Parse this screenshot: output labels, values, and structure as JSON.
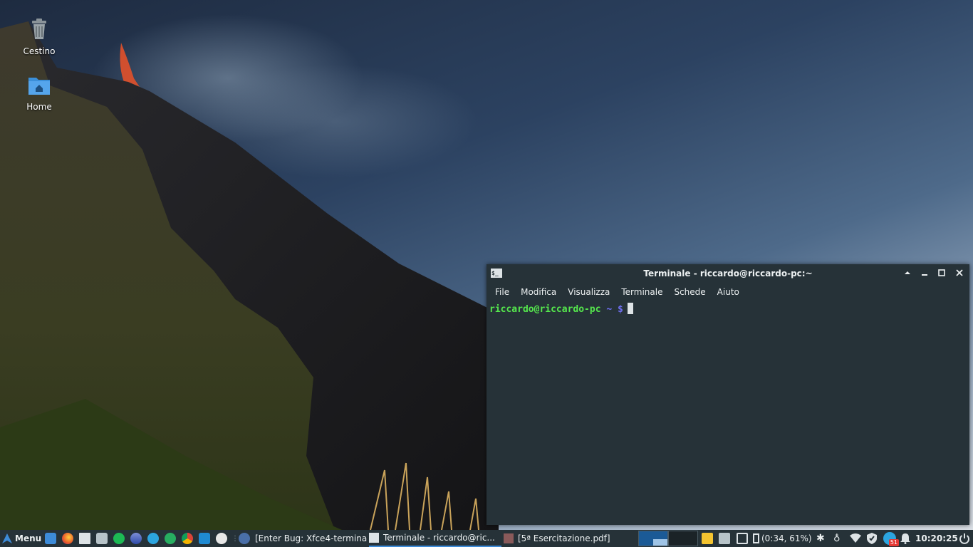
{
  "desktop": {
    "icons": [
      {
        "label": "Cestino",
        "icon": "trash-icon"
      },
      {
        "label": "Home",
        "icon": "home-folder-icon"
      }
    ]
  },
  "terminal": {
    "title": "Terminale - riccardo@riccardo-pc:~",
    "title_icon_text": "$_",
    "menu": [
      "File",
      "Modifica",
      "Visualizza",
      "Terminale",
      "Schede",
      "Aiuto"
    ],
    "prompt_user": "riccardo@riccardo-pc",
    "prompt_path": "~ $"
  },
  "taskbar": {
    "menu_label": "Menu",
    "tasks": [
      {
        "label": "[Enter Bug: Xfce4-termina..."
      },
      {
        "label": "Terminale - riccardo@ric..."
      },
      {
        "label": "[5ª Esercitazione.pdf]"
      }
    ],
    "battery": "(0:34, 61%)",
    "clock": "10:20:25",
    "telegram_badge": "51"
  },
  "colors": {
    "panel_bg": "#263238",
    "prompt_user": "#55e84d",
    "prompt_path": "#6f6ff0",
    "active_underline": "#3d8bd8"
  }
}
